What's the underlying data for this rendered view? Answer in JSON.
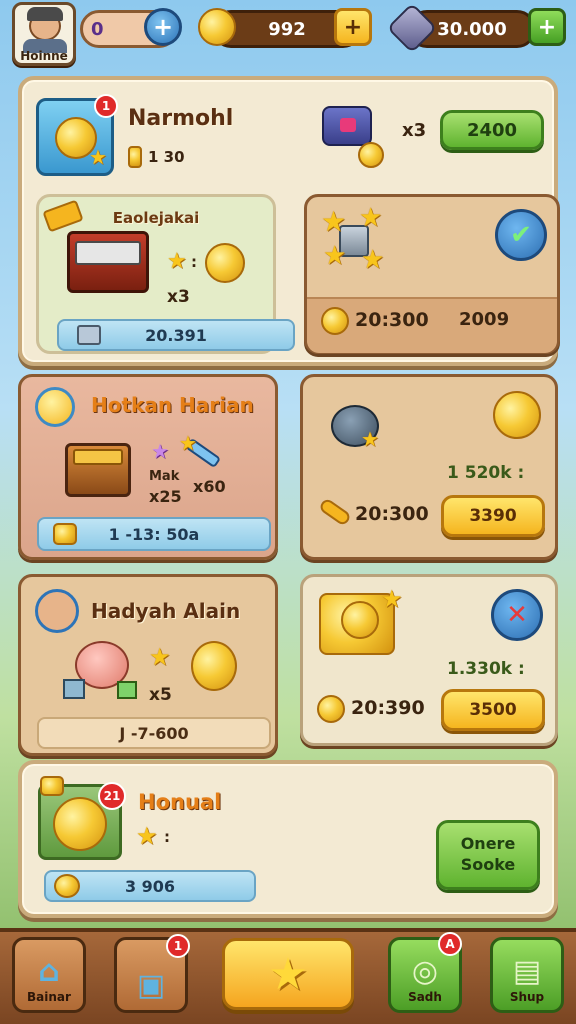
{
  "topbar": {
    "profile_label": "Hoinne",
    "level_value": "0",
    "coins_value": "992",
    "gems_value": "30.000"
  },
  "panel1": {
    "title": "Narmohl",
    "badge": "1",
    "sub_value": "1 30",
    "vehicle_multiplier": "x3",
    "price_button": "2400",
    "sub_card_title": "Eaolejakai",
    "sub_card_multiplier": "x3",
    "sub_card_bar": "20.391",
    "right_card_value1": "20:300",
    "right_card_value2": "2009"
  },
  "card_daily": {
    "title": "Hotkan Harian",
    "label_small": "Mak",
    "value1": "x25",
    "value2": "x60",
    "bar": "1 -13: 50a"
  },
  "card_right1": {
    "value_top": "1 520k :",
    "timer": "20:300",
    "button": "3390"
  },
  "card_gift": {
    "title": "Hadyah Alain",
    "multiplier": "x5",
    "bar": "J -7-600"
  },
  "card_right2": {
    "value_top": "1.330k :",
    "timer": "20:390",
    "button": "3500"
  },
  "card_manual": {
    "title": "Honual",
    "badge": "21",
    "bar": "3 906",
    "button": "Onere Sooke"
  },
  "bottomnav": {
    "items": [
      {
        "label": "Bainar"
      },
      {
        "label": "",
        "badge": "1"
      },
      {
        "label": ""
      },
      {
        "label": "Sadh",
        "badge": "A"
      },
      {
        "label": "Shup"
      }
    ]
  },
  "colors": {
    "panel_bg": "#f3ead3",
    "wood": "#8a5a31",
    "accent_green": "#5fb32f",
    "accent_yellow": "#f5b51f",
    "accent_orange": "#e57f18"
  }
}
